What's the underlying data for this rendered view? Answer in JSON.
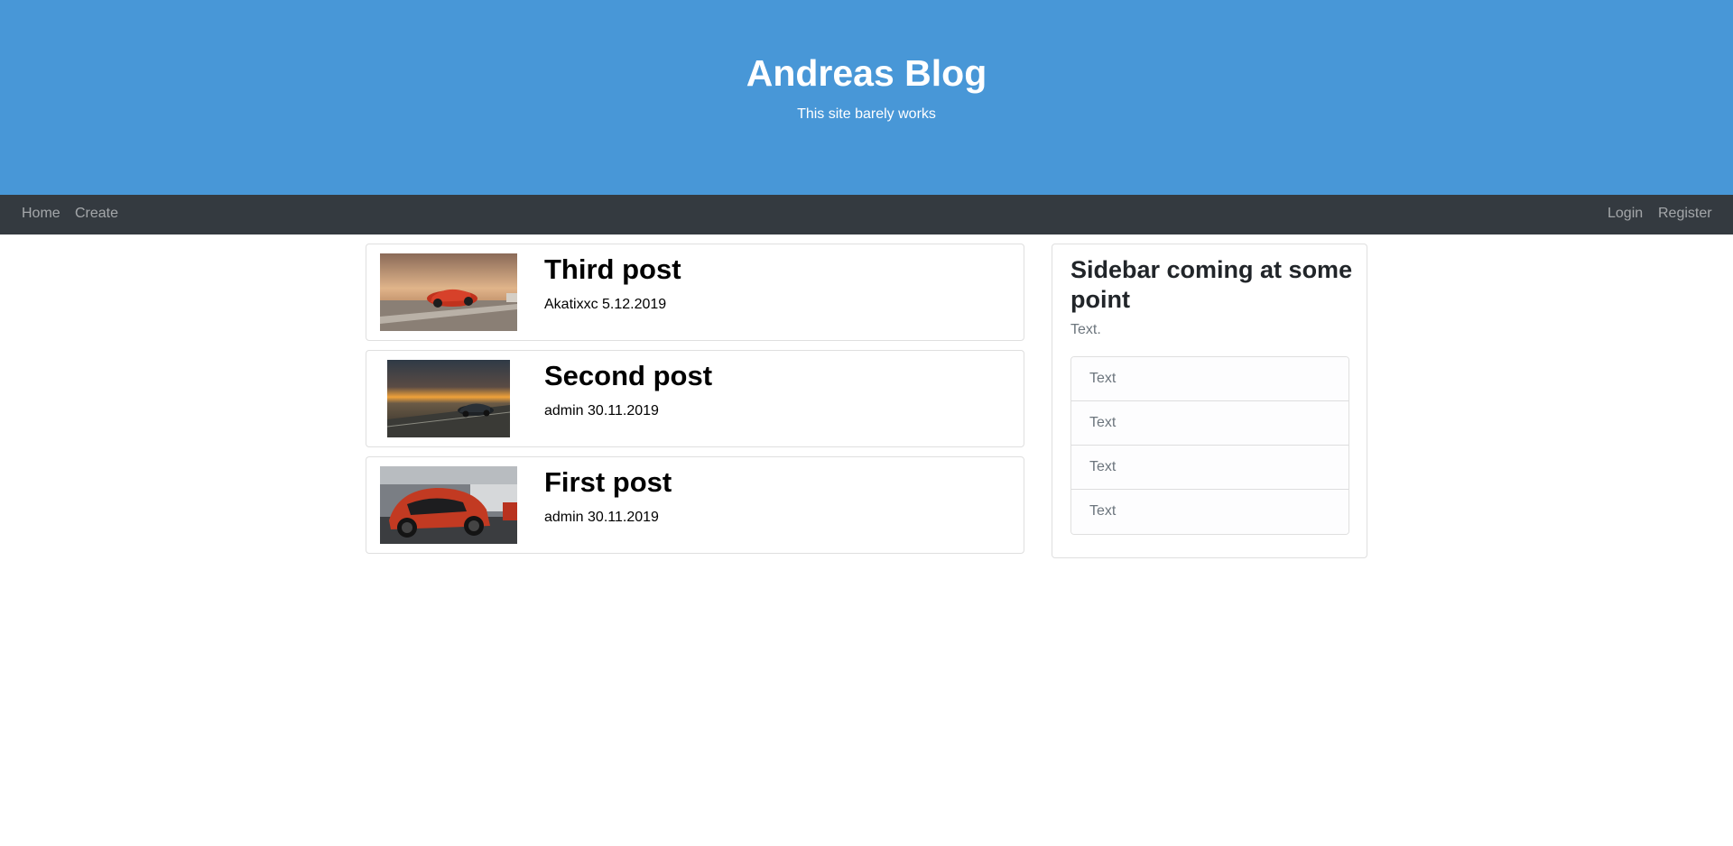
{
  "hero": {
    "title": "Andreas Blog",
    "subtitle": "This site barely works",
    "background_color": "#4897d7"
  },
  "navbar": {
    "left_links": [
      "Home",
      "Create"
    ],
    "right_links": [
      "Login",
      "Register"
    ],
    "background_color": "#343a40"
  },
  "posts": [
    {
      "title": "Third post",
      "meta": "Akatixxc 5.12.2019",
      "image": "red sports car on road at sunset"
    },
    {
      "title": "Second post",
      "meta": "admin 30.11.2019",
      "image": "dark sports car driving at sunset"
    },
    {
      "title": "First post",
      "meta": "admin 30.11.2019",
      "image": "red sports car in showroom"
    }
  ],
  "sidebar": {
    "title": "Sidebar coming at some point",
    "text": "Text.",
    "items": [
      "Text",
      "Text",
      "Text",
      "Text"
    ]
  }
}
